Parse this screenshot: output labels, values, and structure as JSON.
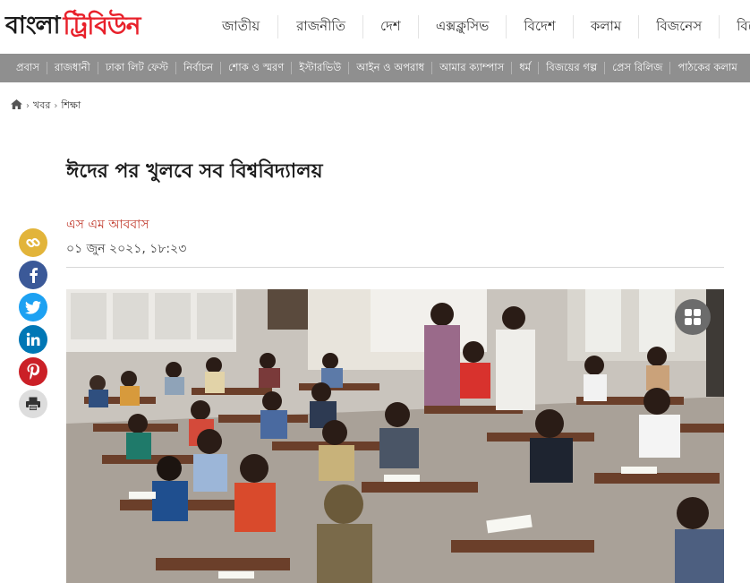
{
  "header": {
    "logo_part1": "বাংলা",
    "logo_part2": "ট্রিবিউন",
    "nav": [
      "জাতীয়",
      "রাজনীতি",
      "দেশ",
      "এক্সক্লুসিভ",
      "বিদেশ",
      "কলাম",
      "বিজনেস",
      "বিনোদন"
    ]
  },
  "subnav": [
    "প্রবাস",
    "রাজধানী",
    "ঢাকা লিট ফেস্ট",
    "নির্বাচন",
    "শোক ও স্মরণ",
    "ইস্টারভিউ",
    "আইন ও অপরাধ",
    "আমার ক্যাম্পাস",
    "ধর্ম",
    "বিজয়ের গল্প",
    "প্রেস রিলিজ",
    "পাঠকের কলাম"
  ],
  "breadcrumb": {
    "home_icon": "home-icon",
    "items": [
      "খবর",
      "শিক্ষা"
    ]
  },
  "article": {
    "title": "ঈদের পর খুলবে সব বিশ্ববিদ্যালয়",
    "author": "এস এম আববাস",
    "date": "০১ জুন ২০২১, ১৮:২৩"
  },
  "social": [
    {
      "name": "link-icon",
      "color": "#e2b43a"
    },
    {
      "name": "facebook-icon",
      "color": "#3b5998"
    },
    {
      "name": "twitter-icon",
      "color": "#1da1f2"
    },
    {
      "name": "linkedin-icon",
      "color": "#0077b5"
    },
    {
      "name": "pinterest-icon",
      "color": "#cb2027"
    },
    {
      "name": "print-icon",
      "color": "#dddddd"
    }
  ],
  "colors": {
    "brand_red": "#e8202a",
    "subnav_bg": "#8f8f8f",
    "author": "#c0392b"
  }
}
